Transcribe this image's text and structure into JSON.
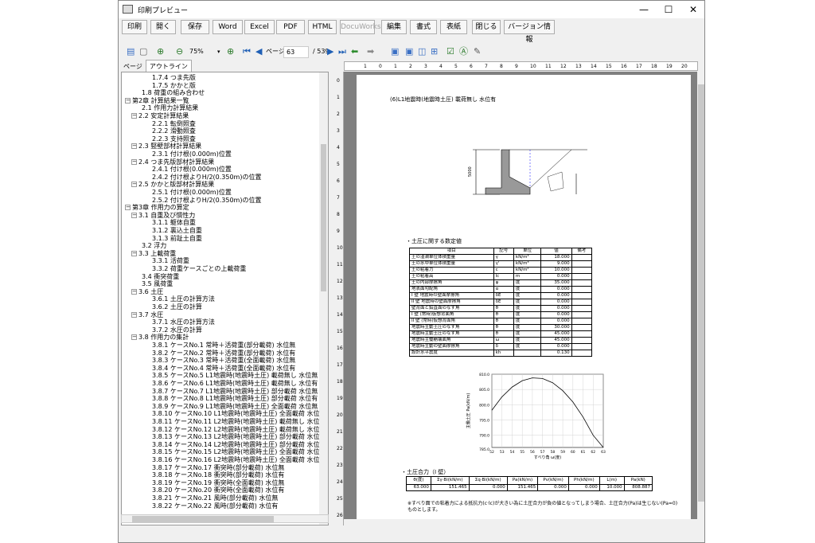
{
  "window": {
    "title": "印刷プレビュー",
    "controls": [
      "—",
      "☐",
      "✕"
    ]
  },
  "toolbar": {
    "buttons": [
      "印刷",
      "開く",
      "保存",
      "Word",
      "Excel",
      "PDF",
      "HTML",
      "DocuWorks",
      "編集",
      "書式",
      "表紙",
      "閉じる",
      "バージョン情報"
    ]
  },
  "viewbar": {
    "zoom": "75%",
    "page_label": "ページ",
    "page": "63",
    "total": "/ 539"
  },
  "tabs": {
    "page": "ページ",
    "outline": "アウトライン"
  },
  "tree": [
    {
      "t": "1.7.4 つま先版",
      "l": 3
    },
    {
      "t": "1.7.5 かかと版",
      "l": 3
    },
    {
      "t": "1.8 荷重の組み合わせ",
      "l": 2
    },
    {
      "t": "第2章 計算結果一覧",
      "l": 0,
      "e": "−"
    },
    {
      "t": "2.1 作用力計算結果",
      "l": 2
    },
    {
      "t": "2.2 安定計算結果",
      "l": 1,
      "e": "−"
    },
    {
      "t": "2.2.1 転倒照査",
      "l": 3
    },
    {
      "t": "2.2.2 滑動照査",
      "l": 3
    },
    {
      "t": "2.2.3 支持照査",
      "l": 3
    },
    {
      "t": "2.3 竪壁部材計算結果",
      "l": 1,
      "e": "−"
    },
    {
      "t": "2.3.1 付け根(0.000m)位置",
      "l": 3
    },
    {
      "t": "2.4 つま先版部材計算結果",
      "l": 1,
      "e": "−"
    },
    {
      "t": "2.4.1 付け根(0.000m)位置",
      "l": 3
    },
    {
      "t": "2.4.2 付け根よりH/2(0.350m)の位置",
      "l": 3
    },
    {
      "t": "2.5 かかと版部材計算結果",
      "l": 1,
      "e": "−"
    },
    {
      "t": "2.5.1 付け根(0.000m)位置",
      "l": 3
    },
    {
      "t": "2.5.2 付け根よりH/2(0.350m)の位置",
      "l": 3
    },
    {
      "t": "第3章 作用力の算定",
      "l": 0,
      "e": "−"
    },
    {
      "t": "3.1 自重及び慣性力",
      "l": 1,
      "e": "−"
    },
    {
      "t": "3.1.1 躯体自重",
      "l": 3
    },
    {
      "t": "3.1.2 裏込土自重",
      "l": 3
    },
    {
      "t": "3.1.3 前趾土自重",
      "l": 3
    },
    {
      "t": "3.2 浮力",
      "l": 2
    },
    {
      "t": "3.3 上載荷重",
      "l": 1,
      "e": "−"
    },
    {
      "t": "3.3.1 活荷重",
      "l": 3
    },
    {
      "t": "3.3.2 荷重ケースごとの上載荷重",
      "l": 3
    },
    {
      "t": "3.4 衝突荷重",
      "l": 2
    },
    {
      "t": "3.5 風荷重",
      "l": 2
    },
    {
      "t": "3.6 土圧",
      "l": 1,
      "e": "−"
    },
    {
      "t": "3.6.1 土圧の計算方法",
      "l": 3
    },
    {
      "t": "3.6.2 土圧の計算",
      "l": 3
    },
    {
      "t": "3.7 水圧",
      "l": 1,
      "e": "−"
    },
    {
      "t": "3.7.1 水圧の計算方法",
      "l": 3
    },
    {
      "t": "3.7.2 水圧の計算",
      "l": 3
    },
    {
      "t": "3.8 作用力の集計",
      "l": 1,
      "e": "−"
    },
    {
      "t": "3.8.1 ケースNo.1 常時＋活荷重(部分載荷) 水位無",
      "l": 3
    },
    {
      "t": "3.8.2 ケースNo.2 常時＋活荷重(部分載荷) 水位有",
      "l": 3
    },
    {
      "t": "3.8.3 ケースNo.3 常時＋活荷重(全面載荷) 水位無",
      "l": 3
    },
    {
      "t": "3.8.4 ケースNo.4 常時＋活荷重(全面載荷) 水位有",
      "l": 3
    },
    {
      "t": "3.8.5 ケースNo.5 L1地震時(地震時土圧) 載荷無し 水位無",
      "l": 3
    },
    {
      "t": "3.8.6 ケースNo.6 L1地震時(地震時土圧) 載荷無し 水位有",
      "l": 3
    },
    {
      "t": "3.8.7 ケースNo.7 L1地震時(地震時土圧) 部分載荷 水位無",
      "l": 3
    },
    {
      "t": "3.8.8 ケースNo.8 L1地震時(地震時土圧) 部分載荷 水位有",
      "l": 3
    },
    {
      "t": "3.8.9 ケースNo.9 L1地震時(地震時土圧) 全面載荷 水位無",
      "l": 3
    },
    {
      "t": "3.8.10 ケースNo.10 L1地震時(地震時土圧) 全面載荷 水位有",
      "l": 3
    },
    {
      "t": "3.8.11 ケースNo.11 L2地震時(地震時土圧) 載荷無し 水位無",
      "l": 3
    },
    {
      "t": "3.8.12 ケースNo.12 L2地震時(地震時土圧) 載荷無し 水位有",
      "l": 3
    },
    {
      "t": "3.8.13 ケースNo.13 L2地震時(地震時土圧) 部分載荷 水位無",
      "l": 3
    },
    {
      "t": "3.8.14 ケースNo.14 L2地震時(地震時土圧) 部分載荷 水位有",
      "l": 3
    },
    {
      "t": "3.8.15 ケースNo.15 L2地震時(地震時土圧) 全面載荷 水位無",
      "l": 3
    },
    {
      "t": "3.8.16 ケースNo.16 L2地震時(地震時土圧) 全面載荷 水位有",
      "l": 3
    },
    {
      "t": "3.8.17 ケースNo.17 衝突時(部分載荷) 水位無",
      "l": 3
    },
    {
      "t": "3.8.18 ケースNo.18 衝突時(部分載荷) 水位有",
      "l": 3
    },
    {
      "t": "3.8.19 ケースNo.19 衝突時(全面載荷) 水位無",
      "l": 3
    },
    {
      "t": "3.8.20 ケースNo.20 衝突時(全面載荷) 水位有",
      "l": 3
    },
    {
      "t": "3.8.21 ケースNo.21 風時(部分載荷) 水位無",
      "l": 3
    },
    {
      "t": "3.8.22 ケースNo.22 風時(部分載荷) 水位有",
      "l": 3
    }
  ],
  "doc": {
    "heading": "(6)L1地震時(地震時土圧) 載荷無し 水位有",
    "section1": "・土圧に関する数定値",
    "soil_head": [
      "項目",
      "記号",
      "単位",
      "値",
      "備考"
    ],
    "soil_rows": [
      [
        "土の湿潤単位体積重量",
        "γ",
        "kN/m³",
        "18.000",
        ""
      ],
      [
        "土の水中単位体積重量",
        "γ'",
        "kN/m³",
        "9.000",
        ""
      ],
      [
        "土の粘着力",
        "c",
        "kN/m²",
        "10.000",
        ""
      ],
      [
        "土の粘着高",
        "lc",
        "m",
        "0.000",
        ""
      ],
      [
        "土の内部摩擦角",
        "φ",
        "度",
        "35.000",
        ""
      ],
      [
        "地表面勾配角",
        "α",
        "度",
        "0.000",
        ""
      ],
      [
        "I 壁 地震時の壁面摩擦角",
        "δE",
        "度",
        "0.000",
        ""
      ],
      [
        "II 壁 地震時の壁面摩擦角",
        "δE",
        "度",
        "0.000",
        ""
      ],
      [
        "壁背面と鉛直面のなす角",
        "θ",
        "度",
        "0.000",
        ""
      ],
      [
        "I 壁 (常時)仮想背面角",
        "θ",
        "度",
        "0.000",
        ""
      ],
      [
        "II 壁 (常時)仮想背面角",
        "θ",
        "度",
        "0.000",
        ""
      ],
      [
        "地震時主動土圧のなす角",
        "θ",
        "度",
        "30.000",
        ""
      ],
      [
        "地震時主動土圧のなす角",
        "θ",
        "度",
        "45.000",
        ""
      ],
      [
        "地震時主働崩壊面角",
        "ω",
        "度",
        "45.000",
        ""
      ],
      [
        "地震時主動の壁面摩擦角",
        "δ",
        "度",
        "0.000",
        ""
      ],
      [
        "設計水平震度",
        "kh",
        "",
        "0.130",
        ""
      ]
    ],
    "section2": "・土圧合力（I 壁）",
    "res_head": [
      "θ(度)",
      "Σγ·Bi(kN/m)",
      "Σq·Bi(kN/m)",
      "Pa(kN/m)",
      "Pv(kN/m)",
      "Ph(kN/m)",
      "L(m)",
      "Pa(kN)"
    ],
    "res_row": [
      "63.000",
      "151.465",
      "0.000",
      "151.465",
      "0.000",
      "0.000",
      "10.000",
      "808.887"
    ],
    "note": "※すべり面での粘着力による抵抗力(c·lc)が大きい為に土圧合力が負の値となってしまう場合、土圧合力(Pa)は生じない(Pa=0)ものとします。",
    "dim_label": "5000"
  },
  "chart_data": {
    "type": "line",
    "title": "",
    "xlabel": "すべり角 ω(度)",
    "ylabel": "主働土圧 Pa(kN/m)",
    "x": [
      52,
      53,
      54,
      55,
      56,
      57,
      58,
      59,
      60,
      61,
      62,
      63
    ],
    "y": [
      798.2,
      802.6,
      805.8,
      807.9,
      808.8,
      808.6,
      807.2,
      804.6,
      800.9,
      796.0,
      790.0,
      786.0
    ],
    "xlim": [
      52,
      63
    ],
    "ylim": [
      786,
      810
    ],
    "yticks": [
      "810.0",
      "805.0",
      "800.0",
      "795.0",
      "790.0",
      "785.0"
    ],
    "xticks": [
      "52",
      "53",
      "54",
      "55",
      "56",
      "57",
      "58",
      "59",
      "60",
      "61",
      "62",
      "63"
    ],
    "grid": true
  }
}
